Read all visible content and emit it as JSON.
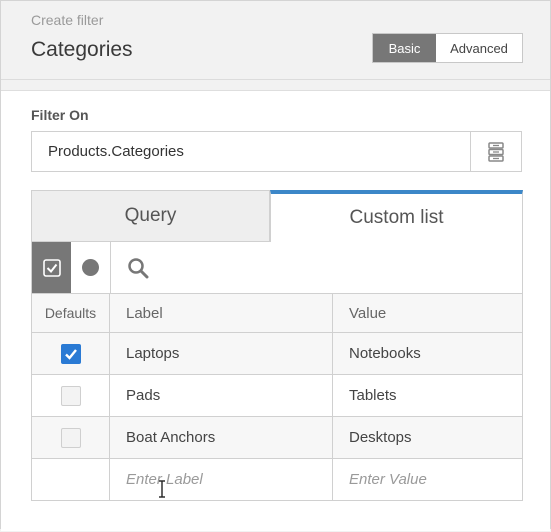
{
  "header": {
    "subtitle": "Create filter",
    "title": "Categories",
    "toggle": {
      "basic": "Basic",
      "advanced": "Advanced"
    }
  },
  "filter": {
    "label": "Filter On",
    "value": "Products.Categories"
  },
  "tabs": {
    "query": "Query",
    "custom": "Custom list"
  },
  "table": {
    "headers": {
      "defaults": "Defaults",
      "label": "Label",
      "value": "Value"
    },
    "rows": [
      {
        "checked": true,
        "label": "Laptops",
        "value": "Notebooks"
      },
      {
        "checked": false,
        "label": "Pads",
        "value": "Tablets"
      },
      {
        "checked": false,
        "label": "Boat Anchors",
        "value": "Desktops"
      }
    ],
    "placeholder_row": {
      "label": "Enter Label",
      "value": "Enter Value"
    }
  },
  "colors": {
    "accent": "#3c87c8",
    "checkbox_checked": "#2a7ad4",
    "toggle_active": "#777777"
  }
}
